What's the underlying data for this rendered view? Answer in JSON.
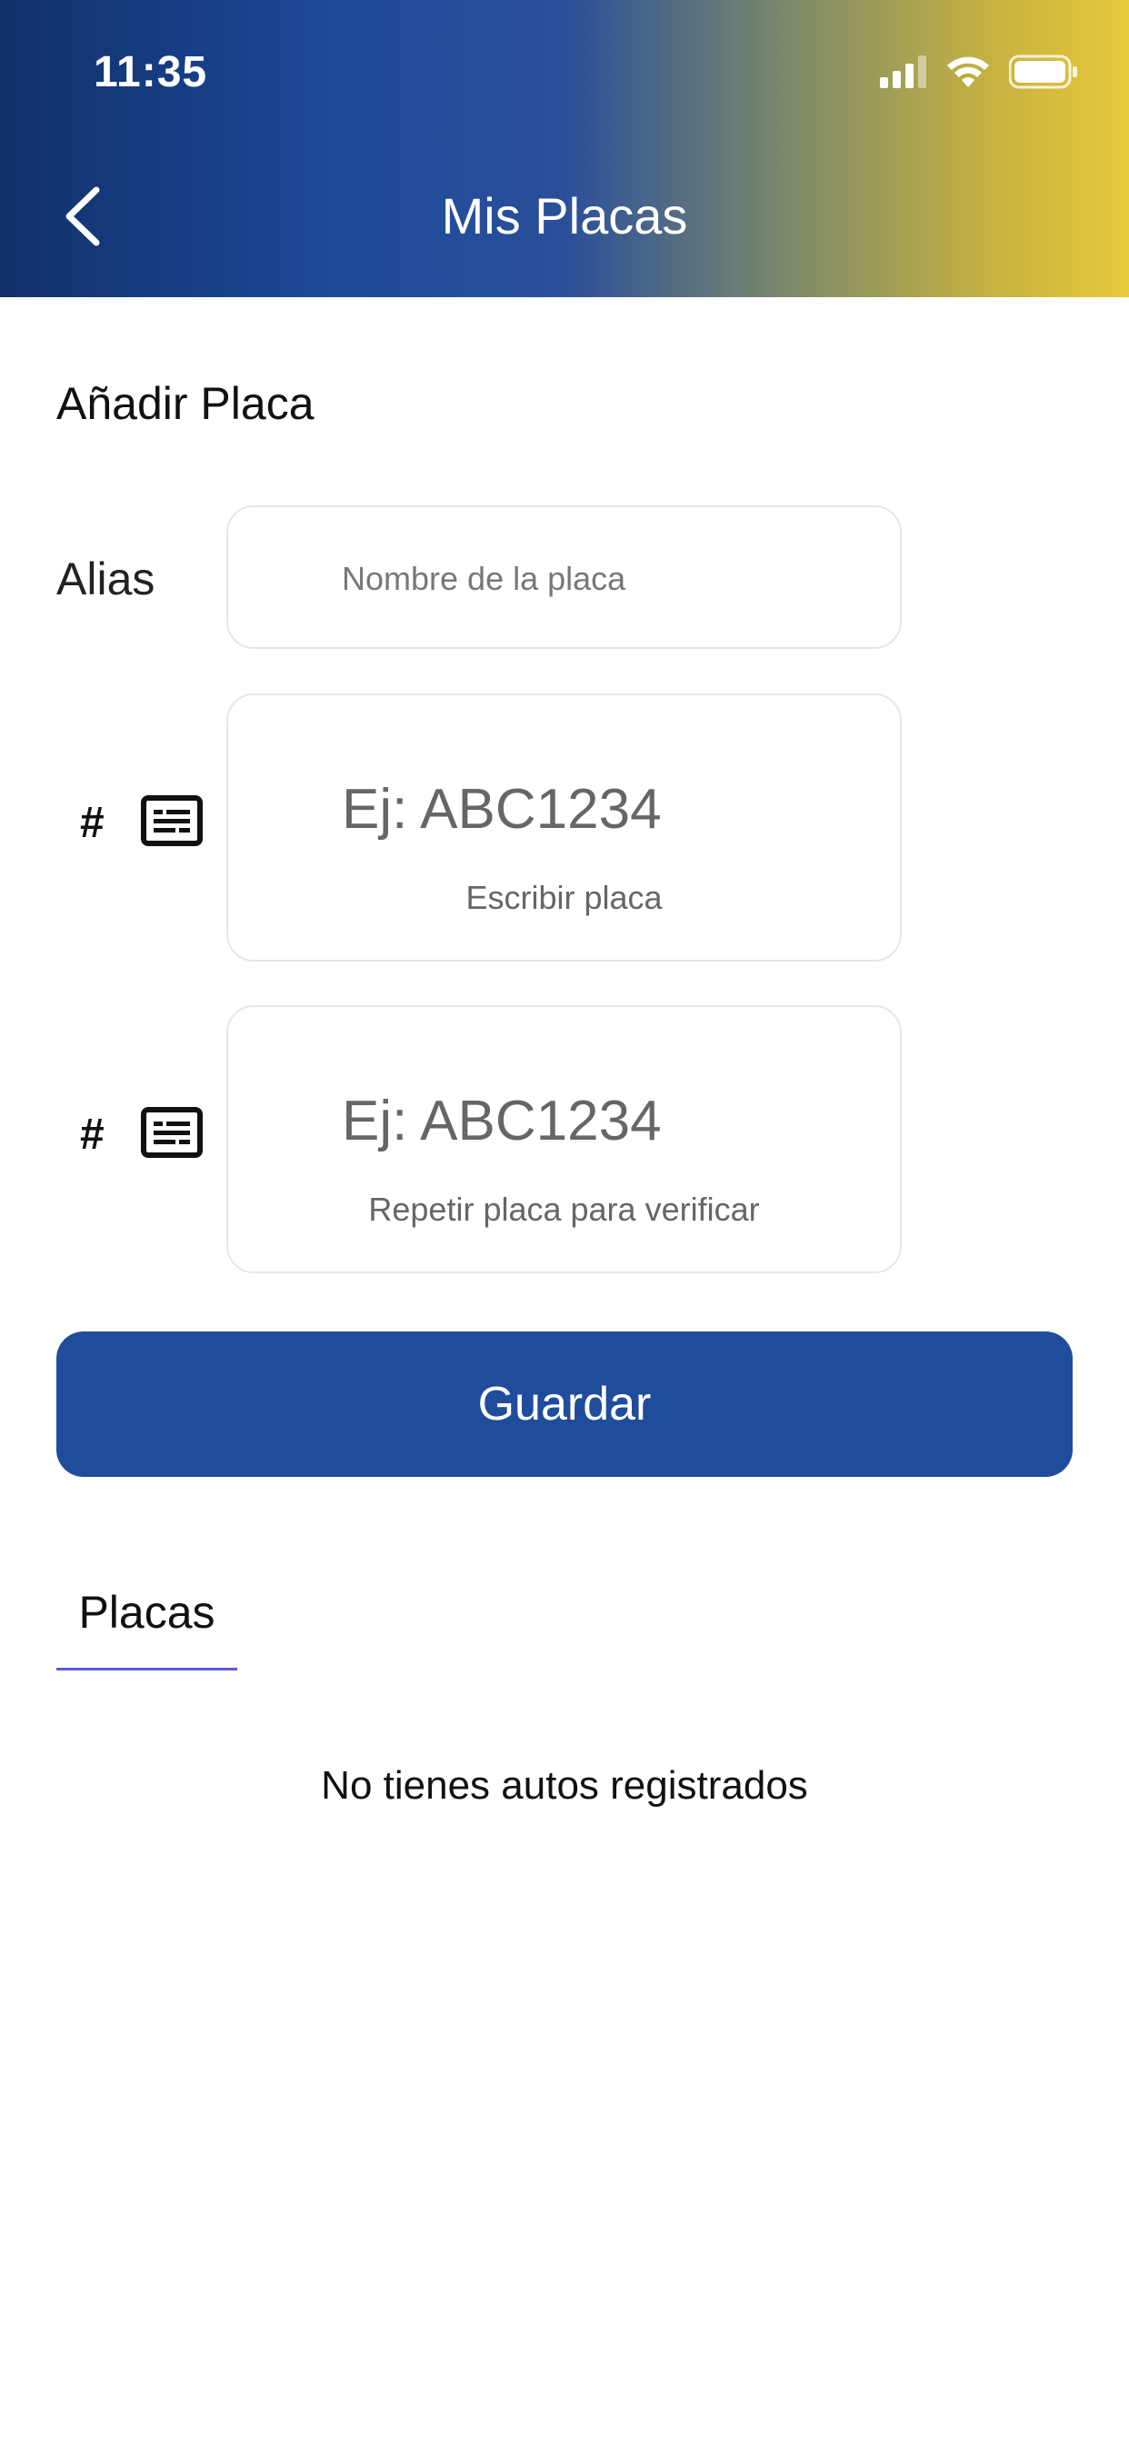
{
  "status_bar": {
    "time": "11:35",
    "icons": [
      "cellular-signal-icon",
      "wifi-icon",
      "battery-icon"
    ]
  },
  "header": {
    "title": "Mis Placas",
    "back_icon": "chevron-left-icon"
  },
  "form": {
    "section_title": "Añadir Placa",
    "alias_label": "Alias",
    "alias_placeholder": "Nombre de la placa",
    "plate_symbol": "#",
    "plate_icon": "license-plate-icon",
    "plate_placeholder": "Ej: ABC1234",
    "plate_caption": "Escribir placa",
    "plate_confirm_placeholder": "Ej: ABC1234",
    "plate_confirm_caption": "Repetir placa para verificar",
    "save_label": "Guardar"
  },
  "plates": {
    "tab_label": "Placas",
    "empty_message": "No tienes autos registrados"
  },
  "colors": {
    "primary": "#1f4d9c",
    "header_gradient_start": "#10306a",
    "header_gradient_end": "#e8c93a",
    "tab_underline": "#5b5bd6"
  }
}
